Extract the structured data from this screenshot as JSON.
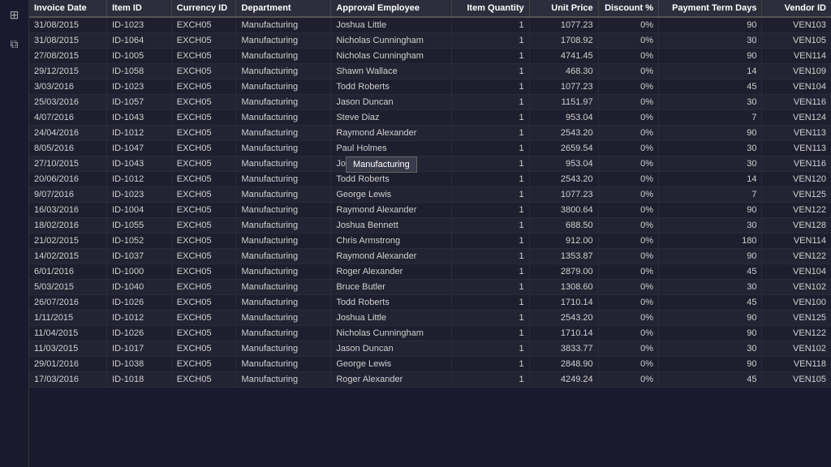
{
  "sidebar": {
    "icons": [
      {
        "name": "grid-icon",
        "symbol": "⊞"
      },
      {
        "name": "layers-icon",
        "symbol": "⧉"
      }
    ]
  },
  "table": {
    "columns": [
      {
        "key": "invoiceDate",
        "label": "Invoice Date",
        "class": "col-date"
      },
      {
        "key": "itemId",
        "label": "Item ID",
        "class": "col-itemid"
      },
      {
        "key": "currencyId",
        "label": "Currency ID",
        "class": "col-currency"
      },
      {
        "key": "department",
        "label": "Department",
        "class": "col-dept"
      },
      {
        "key": "approvalEmployee",
        "label": "Approval Employee",
        "class": "col-approval"
      },
      {
        "key": "itemQuantity",
        "label": "Item Quantity",
        "class": "col-qty"
      },
      {
        "key": "unitPrice",
        "label": "Unit Price",
        "class": "col-price"
      },
      {
        "key": "discount",
        "label": "Discount %",
        "class": "col-discount"
      },
      {
        "key": "paymentTermDays",
        "label": "Payment Term Days",
        "class": "col-payment"
      },
      {
        "key": "vendorId",
        "label": "Vendor ID",
        "class": "col-vendor"
      }
    ],
    "rows": [
      {
        "invoiceDate": "31/08/2015",
        "itemId": "ID-1023",
        "currencyId": "EXCH05",
        "department": "Manufacturing",
        "approvalEmployee": "Joshua Little",
        "itemQuantity": "1",
        "unitPrice": "1077.23",
        "discount": "0%",
        "paymentTermDays": "90",
        "vendorId": "VEN103"
      },
      {
        "invoiceDate": "31/08/2015",
        "itemId": "ID-1064",
        "currencyId": "EXCH05",
        "department": "Manufacturing",
        "approvalEmployee": "Nicholas Cunningham",
        "itemQuantity": "1",
        "unitPrice": "1708.92",
        "discount": "0%",
        "paymentTermDays": "30",
        "vendorId": "VEN105"
      },
      {
        "invoiceDate": "27/08/2015",
        "itemId": "ID-1005",
        "currencyId": "EXCH05",
        "department": "Manufacturing",
        "approvalEmployee": "Nicholas Cunningham",
        "itemQuantity": "1",
        "unitPrice": "4741.45",
        "discount": "0%",
        "paymentTermDays": "90",
        "vendorId": "VEN114"
      },
      {
        "invoiceDate": "29/12/2015",
        "itemId": "ID-1058",
        "currencyId": "EXCH05",
        "department": "Manufacturing",
        "approvalEmployee": "Shawn Wallace",
        "itemQuantity": "1",
        "unitPrice": "468.30",
        "discount": "0%",
        "paymentTermDays": "14",
        "vendorId": "VEN109"
      },
      {
        "invoiceDate": "3/03/2016",
        "itemId": "ID-1023",
        "currencyId": "EXCH05",
        "department": "Manufacturing",
        "approvalEmployee": "Todd Roberts",
        "itemQuantity": "1",
        "unitPrice": "1077.23",
        "discount": "0%",
        "paymentTermDays": "45",
        "vendorId": "VEN104"
      },
      {
        "invoiceDate": "25/03/2016",
        "itemId": "ID-1057",
        "currencyId": "EXCH05",
        "department": "Manufacturing",
        "approvalEmployee": "Jason Duncan",
        "itemQuantity": "1",
        "unitPrice": "1151.97",
        "discount": "0%",
        "paymentTermDays": "30",
        "vendorId": "VEN116"
      },
      {
        "invoiceDate": "4/07/2016",
        "itemId": "ID-1043",
        "currencyId": "EXCH05",
        "department": "Manufacturing",
        "approvalEmployee": "Steve Diaz",
        "itemQuantity": "1",
        "unitPrice": "953.04",
        "discount": "0%",
        "paymentTermDays": "7",
        "vendorId": "VEN124"
      },
      {
        "invoiceDate": "24/04/2016",
        "itemId": "ID-1012",
        "currencyId": "EXCH05",
        "department": "Manufacturing",
        "approvalEmployee": "Raymond Alexander",
        "itemQuantity": "1",
        "unitPrice": "2543.20",
        "discount": "0%",
        "paymentTermDays": "90",
        "vendorId": "VEN113"
      },
      {
        "invoiceDate": "8/05/2016",
        "itemId": "ID-1047",
        "currencyId": "EXCH05",
        "department": "Manufacturing",
        "approvalEmployee": "Paul Holmes",
        "itemQuantity": "1",
        "unitPrice": "2659.54",
        "discount": "0%",
        "paymentTermDays": "30",
        "vendorId": "VEN113"
      },
      {
        "invoiceDate": "27/10/2015",
        "itemId": "ID-1043",
        "currencyId": "EXCH05",
        "department": "Manufacturing",
        "approvalEmployee": "Joshua Bennett",
        "itemQuantity": "1",
        "unitPrice": "953.04",
        "discount": "0%",
        "paymentTermDays": "30",
        "vendorId": "VEN116"
      },
      {
        "invoiceDate": "20/06/2016",
        "itemId": "ID-1012",
        "currencyId": "EXCH05",
        "department": "Manufacturing",
        "approvalEmployee": "Todd Roberts",
        "itemQuantity": "1",
        "unitPrice": "2543.20",
        "discount": "0%",
        "paymentTermDays": "14",
        "vendorId": "VEN120"
      },
      {
        "invoiceDate": "9/07/2016",
        "itemId": "ID-1023",
        "currencyId": "EXCH05",
        "department": "Manufacturing",
        "approvalEmployee": "George Lewis",
        "itemQuantity": "1",
        "unitPrice": "1077.23",
        "discount": "0%",
        "paymentTermDays": "7",
        "vendorId": "VEN125"
      },
      {
        "invoiceDate": "16/03/2016",
        "itemId": "ID-1004",
        "currencyId": "EXCH05",
        "department": "Manufacturing",
        "approvalEmployee": "Raymond Alexander",
        "itemQuantity": "1",
        "unitPrice": "3800.64",
        "discount": "0%",
        "paymentTermDays": "90",
        "vendorId": "VEN122"
      },
      {
        "invoiceDate": "18/02/2016",
        "itemId": "ID-1055",
        "currencyId": "EXCH05",
        "department": "Manufacturing",
        "approvalEmployee": "Joshua Bennett",
        "itemQuantity": "1",
        "unitPrice": "688.50",
        "discount": "0%",
        "paymentTermDays": "30",
        "vendorId": "VEN128"
      },
      {
        "invoiceDate": "21/02/2015",
        "itemId": "ID-1052",
        "currencyId": "EXCH05",
        "department": "Manufacturing",
        "approvalEmployee": "Chris Armstrong",
        "itemQuantity": "1",
        "unitPrice": "912.00",
        "discount": "0%",
        "paymentTermDays": "180",
        "vendorId": "VEN114"
      },
      {
        "invoiceDate": "14/02/2015",
        "itemId": "ID-1037",
        "currencyId": "EXCH05",
        "department": "Manufacturing",
        "approvalEmployee": "Raymond Alexander",
        "itemQuantity": "1",
        "unitPrice": "1353.87",
        "discount": "0%",
        "paymentTermDays": "90",
        "vendorId": "VEN122"
      },
      {
        "invoiceDate": "6/01/2016",
        "itemId": "ID-1000",
        "currencyId": "EXCH05",
        "department": "Manufacturing",
        "approvalEmployee": "Roger Alexander",
        "itemQuantity": "1",
        "unitPrice": "2879.00",
        "discount": "0%",
        "paymentTermDays": "45",
        "vendorId": "VEN104"
      },
      {
        "invoiceDate": "5/03/2015",
        "itemId": "ID-1040",
        "currencyId": "EXCH05",
        "department": "Manufacturing",
        "approvalEmployee": "Bruce Butler",
        "itemQuantity": "1",
        "unitPrice": "1308.60",
        "discount": "0%",
        "paymentTermDays": "30",
        "vendorId": "VEN102"
      },
      {
        "invoiceDate": "26/07/2016",
        "itemId": "ID-1026",
        "currencyId": "EXCH05",
        "department": "Manufacturing",
        "approvalEmployee": "Todd Roberts",
        "itemQuantity": "1",
        "unitPrice": "1710.14",
        "discount": "0%",
        "paymentTermDays": "45",
        "vendorId": "VEN100"
      },
      {
        "invoiceDate": "1/11/2015",
        "itemId": "ID-1012",
        "currencyId": "EXCH05",
        "department": "Manufacturing",
        "approvalEmployee": "Joshua Little",
        "itemQuantity": "1",
        "unitPrice": "2543.20",
        "discount": "0%",
        "paymentTermDays": "90",
        "vendorId": "VEN125"
      },
      {
        "invoiceDate": "11/04/2015",
        "itemId": "ID-1026",
        "currencyId": "EXCH05",
        "department": "Manufacturing",
        "approvalEmployee": "Nicholas Cunningham",
        "itemQuantity": "1",
        "unitPrice": "1710.14",
        "discount": "0%",
        "paymentTermDays": "90",
        "vendorId": "VEN122"
      },
      {
        "invoiceDate": "11/03/2015",
        "itemId": "ID-1017",
        "currencyId": "EXCH05",
        "department": "Manufacturing",
        "approvalEmployee": "Jason Duncan",
        "itemQuantity": "1",
        "unitPrice": "3833.77",
        "discount": "0%",
        "paymentTermDays": "30",
        "vendorId": "VEN102"
      },
      {
        "invoiceDate": "29/01/2016",
        "itemId": "ID-1038",
        "currencyId": "EXCH05",
        "department": "Manufacturing",
        "approvalEmployee": "George Lewis",
        "itemQuantity": "1",
        "unitPrice": "2848.90",
        "discount": "0%",
        "paymentTermDays": "90",
        "vendorId": "VEN118"
      },
      {
        "invoiceDate": "17/03/2016",
        "itemId": "ID-1018",
        "currencyId": "EXCH05",
        "department": "Manufacturing",
        "approvalEmployee": "Roger Alexander",
        "itemQuantity": "1",
        "unitPrice": "4249.24",
        "discount": "0%",
        "paymentTermDays": "45",
        "vendorId": "VEN105"
      }
    ],
    "tooltip": "Manufacturing"
  }
}
